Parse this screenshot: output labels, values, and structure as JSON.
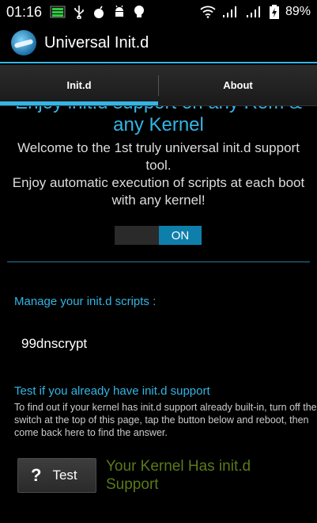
{
  "status_bar": {
    "time": "01:16",
    "battery_percent": "89%",
    "icons": [
      "battery-meter-icon",
      "usb-icon",
      "bomb-icon",
      "android-icon",
      "lightbulb-icon",
      "wifi-icon",
      "signal-icon",
      "signal-icon-2",
      "battery-charging-icon"
    ]
  },
  "app": {
    "title": "Universal Init.d",
    "logo": "app-logo-icon"
  },
  "tabs": [
    {
      "label": "Init.d",
      "selected": true
    },
    {
      "label": "About",
      "selected": false
    }
  ],
  "content": {
    "headline": "Enjoy init.d support on any Rom & any Kernel",
    "welcome": "Welcome to the 1st truly universal init.d support tool.\nEnjoy automatic execution of scripts at each boot with any kernel!",
    "toggle": {
      "state": "ON"
    },
    "manage_label": "Manage your init.d scripts :",
    "scripts": [
      "99dnscrypt"
    ],
    "test_heading": "Test if you already have init.d support",
    "test_description": "To find out if your kernel has init.d support already built-in, turn off the switch at the top of this page, tap the button below and reboot, then come back here to find the answer.",
    "test_button": {
      "icon": "?",
      "label": "Test"
    },
    "result": "Your Kernel Has init.d Support"
  },
  "colors": {
    "accent": "#33b5e5",
    "toggle_on": "#0e7fab",
    "result_text": "#5a7a1a",
    "background": "#000000"
  }
}
